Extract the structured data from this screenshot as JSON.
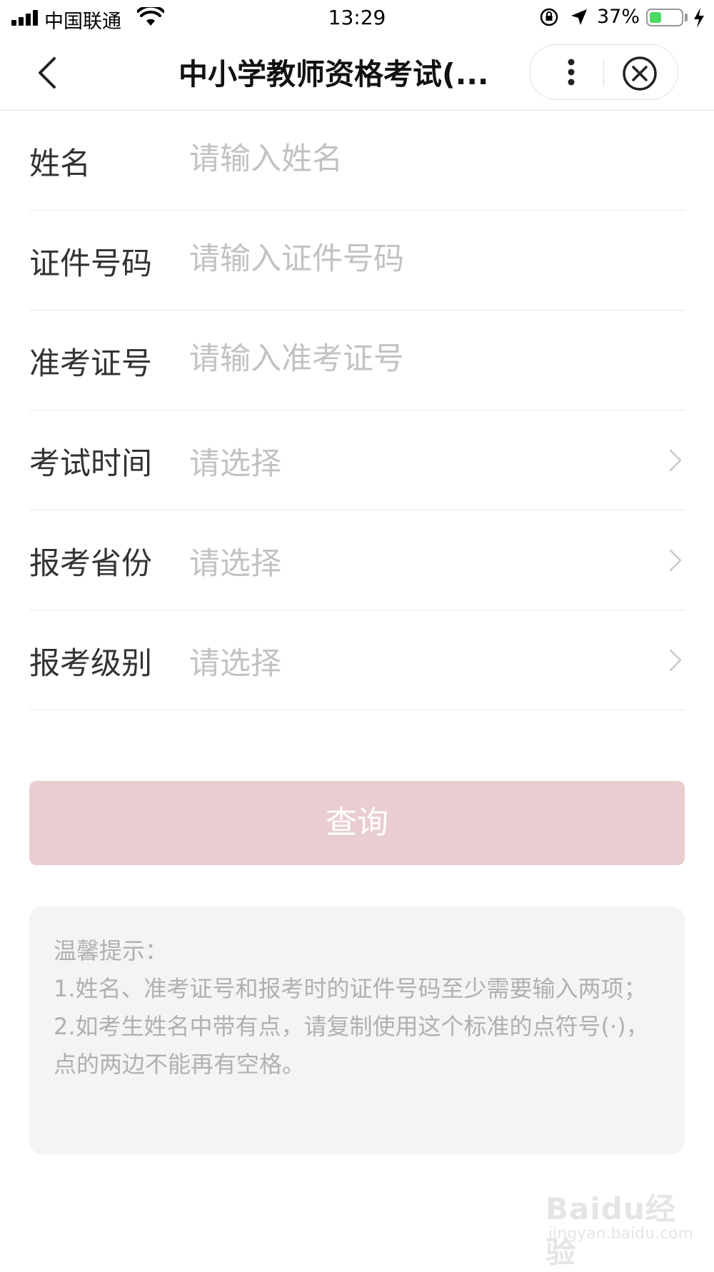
{
  "status_bar": {
    "carrier": "中国联通",
    "time": "13:29",
    "battery_percent": "37%",
    "battery_level": 0.37,
    "icons": [
      "signal-icon",
      "wifi-icon",
      "rotation-lock-icon",
      "location-icon",
      "battery-icon",
      "charging-icon"
    ]
  },
  "nav": {
    "title": "中小学教师资格考试(...",
    "back_icon": "chevron-left-icon",
    "more_icon": "more-dots-icon",
    "close_icon": "close-circle-icon"
  },
  "form": {
    "name": {
      "label": "姓名",
      "placeholder": "请输入姓名"
    },
    "id_number": {
      "label": "证件号码",
      "placeholder": "请输入证件号码"
    },
    "admission_number": {
      "label": "准考证号",
      "placeholder": "请输入准考证号"
    },
    "exam_time": {
      "label": "考试时间",
      "value": "请选择"
    },
    "province": {
      "label": "报考省份",
      "value": "请选择"
    },
    "level": {
      "label": "报考级别",
      "value": "请选择"
    }
  },
  "query_button": {
    "label": "查询",
    "color": "#eacdd0"
  },
  "tips": {
    "title": "温馨提示：",
    "line1": "1.姓名、准考证号和报考时的证件号码至少需要输入两项；",
    "line2": "2.如考生姓名中带有点，请复制使用这个标准的点符号(·)，点的两边不能再有空格。"
  },
  "watermark": {
    "logo": "Baidu经验",
    "url": "jingyan.baidu.com"
  }
}
